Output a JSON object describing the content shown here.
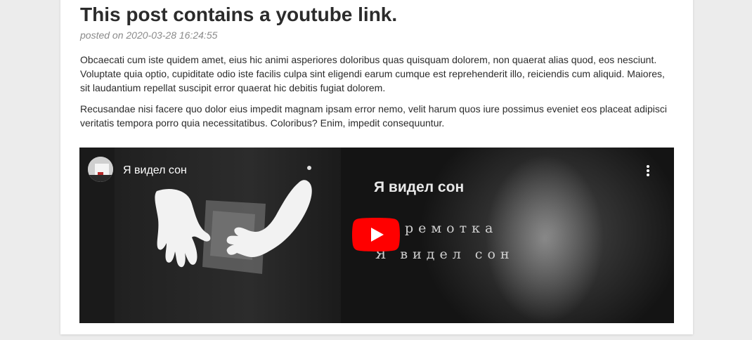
{
  "post": {
    "title": "This post contains a youtube link.",
    "meta": "posted on 2020-03-28 16:24:55",
    "paragraphs": [
      "Obcaecati cum iste quidem amet, eius hic animi asperiores doloribus quas quisquam dolorem, non quaerat alias quod, eos nesciunt. Voluptate quia optio, cupiditate odio iste facilis culpa sint eligendi earum cumque est reprehenderit illo, reiciendis cum aliquid. Maiores, sit laudantium repellat suscipit error quaerat hic debitis fugiat dolorem.",
      "Recusandae nisi facere quo dolor eius impedit magnam ipsam error nemo, velit harum quos iure possimus eveniet eos placeat adipisci veritatis tempora porro quia necessitatibus. Coloribus? Enim, impedit consequuntur."
    ]
  },
  "video": {
    "title": "Я видел сон",
    "overlay_title": "Я видел сон",
    "overlay_line1": "ремотка",
    "overlay_line2": "Я видел сон",
    "play_icon": "youtube-play-icon",
    "menu_icon": "more-vertical-icon",
    "colors": {
      "play_red": "#ff0000",
      "background": "#1a1a1a"
    }
  }
}
